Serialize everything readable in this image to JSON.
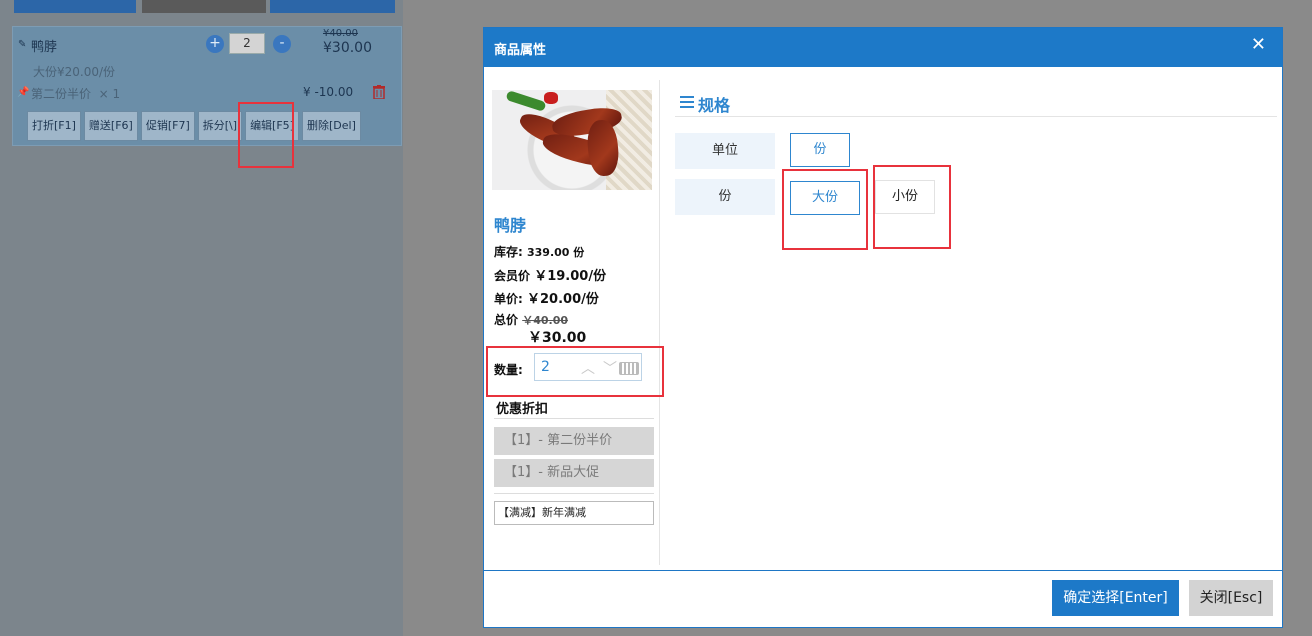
{
  "background": {
    "order_item": {
      "name": "鸭脖",
      "quantity": "2",
      "plus": "+",
      "minus": "-",
      "original_price": "¥40.00",
      "price": "¥30.00",
      "variant": "大份¥20.00/份",
      "promotion": "第二份半价",
      "promotion_count": "× 1",
      "discount": "¥ -10.00",
      "actions": [
        "打折[F1]",
        "赠送[F6]",
        "促销[F7]",
        "拆分[\\]",
        "编辑[F5]",
        "删除[Del]"
      ]
    }
  },
  "modal": {
    "title": "商品属性",
    "close": "✕",
    "product": {
      "name": "鸭脖",
      "stock_label": "库存:",
      "stock_value": "339.00 份",
      "member_label": "会员价",
      "member_value": "￥19.00/份",
      "unit_label": "单价:",
      "unit_value": "￥20.00/份",
      "total_label": "总价",
      "total_original": "￥40.00",
      "total_value": "￥30.00",
      "qty_label": "数量:",
      "qty_value": "2"
    },
    "promotions": {
      "title": "优惠折扣",
      "items": [
        "【1】- 第二份半价",
        "【1】- 新品大促"
      ],
      "full_reduction": "【满减】新年满减"
    },
    "spec": {
      "title": "规格",
      "rows": [
        {
          "label": "单位",
          "options": [
            {
              "text": "份",
              "selected": true
            }
          ]
        },
        {
          "label": "份",
          "options": [
            {
              "text": "大份",
              "selected": true
            },
            {
              "text": "小份",
              "selected": false
            }
          ]
        }
      ]
    },
    "buttons": {
      "confirm": "确定选择[Enter]",
      "close": "关闭[Esc]"
    }
  },
  "colors": {
    "accent": "#1d79c8",
    "highlight": "#e8323c",
    "selected_text": "#2e86cf"
  }
}
